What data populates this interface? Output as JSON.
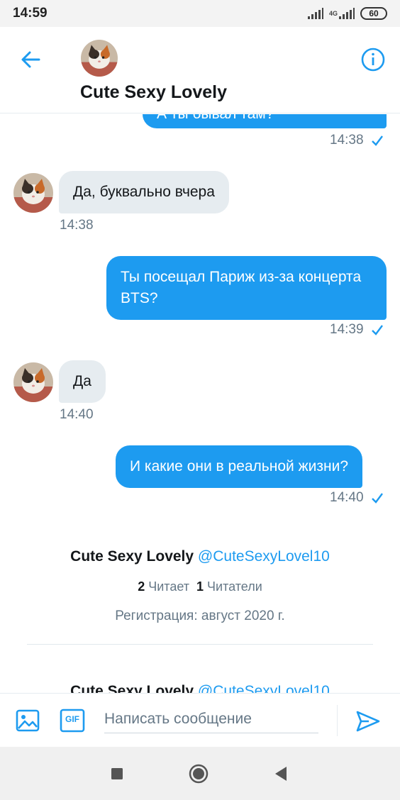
{
  "status_bar": {
    "time": "14:59",
    "network": "4G",
    "battery": "60"
  },
  "header": {
    "title": "Cute Sexy Lovely"
  },
  "messages": [
    {
      "dir": "out",
      "text": "А ты бывал там?",
      "time": "14:38"
    },
    {
      "dir": "in",
      "text": "Да, буквально вчера",
      "time": "14:38"
    },
    {
      "dir": "out",
      "text": "Ты посещал Париж из-за концерта BTS?",
      "time": "14:39"
    },
    {
      "dir": "in",
      "text": "Да",
      "time": "14:40"
    },
    {
      "dir": "out",
      "text": "И какие они в реальной жизни?",
      "time": "14:40"
    }
  ],
  "profile": {
    "name": "Cute Sexy Lovely",
    "handle": "@CuteSexyLovel10",
    "following_count": "2",
    "following_label": "Читает",
    "followers_count": "1",
    "followers_label": "Читатели",
    "joined": "Регистрация: август 2020 г."
  },
  "composer": {
    "placeholder": "Написать сообщение",
    "gif_label": "GIF"
  },
  "colors": {
    "accent": "#1d9bf0",
    "incoming_bubble": "#e6ecf0",
    "muted_text": "#657786"
  },
  "icons": [
    "back-arrow-icon",
    "info-icon",
    "image-icon",
    "gif-icon",
    "send-icon",
    "nav-square-icon",
    "nav-circle-icon",
    "nav-back-icon"
  ]
}
